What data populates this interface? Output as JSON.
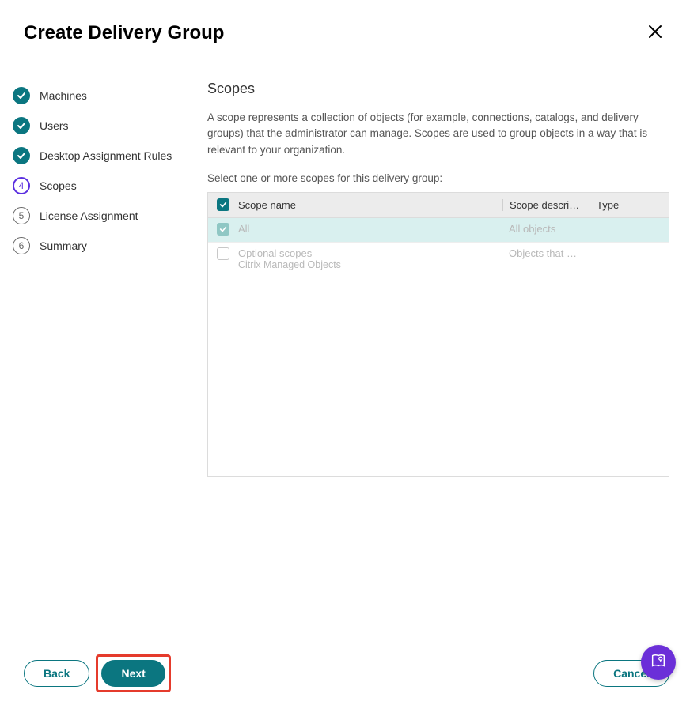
{
  "title": "Create Delivery Group",
  "steps": [
    {
      "label": "Machines",
      "state": "done"
    },
    {
      "label": "Users",
      "state": "done"
    },
    {
      "label": "Desktop Assignment Rules",
      "state": "done"
    },
    {
      "label": "Scopes",
      "state": "current",
      "num": "4"
    },
    {
      "label": "License Assignment",
      "state": "upcoming",
      "num": "5"
    },
    {
      "label": "Summary",
      "state": "upcoming",
      "num": "6"
    }
  ],
  "section": {
    "heading": "Scopes",
    "description": "A scope represents a collection of objects (for example, connections, catalogs, and delivery groups) that the administrator can manage. Scopes are used to group objects in a way that is relevant to your organization.",
    "instruction": "Select one or more scopes for this delivery group:"
  },
  "table": {
    "cols": {
      "name": "Scope name",
      "desc": "Scope descrip…",
      "type": "Type"
    },
    "rows": [
      {
        "name": "All",
        "sub": "",
        "desc": "All objects",
        "type": "",
        "checked": true,
        "selected": true,
        "muted": true
      },
      {
        "name": "Optional scopes",
        "sub": "Citrix Managed Objects",
        "desc": "Objects that m…",
        "type": "",
        "checked": false,
        "selected": false,
        "muted": true
      }
    ]
  },
  "buttons": {
    "back": "Back",
    "next": "Next",
    "cancel": "Cancel"
  }
}
